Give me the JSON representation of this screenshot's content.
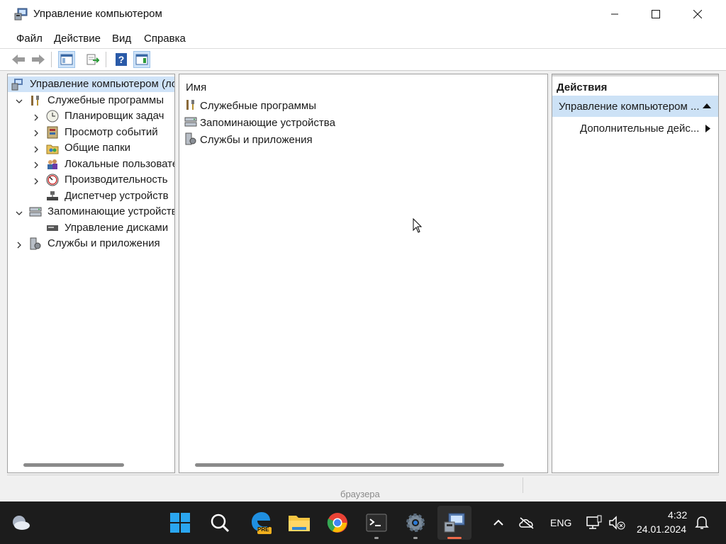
{
  "window": {
    "title": "Управление компьютером",
    "menu": [
      "Файл",
      "Действие",
      "Вид",
      "Справка"
    ]
  },
  "tree": {
    "root": "Управление компьютером (локальным)",
    "items": [
      {
        "label": "Служебные программы",
        "icon": "tools-icon"
      },
      {
        "label": "Планировщик задач",
        "icon": "clock-icon"
      },
      {
        "label": "Просмотр событий",
        "icon": "event-viewer-icon"
      },
      {
        "label": "Общие папки",
        "icon": "shared-folder-icon"
      },
      {
        "label": "Локальные пользователи и группы",
        "icon": "users-icon"
      },
      {
        "label": "Производительность",
        "icon": "performance-icon"
      },
      {
        "label": "Диспетчер устройств",
        "icon": "device-manager-icon"
      },
      {
        "label": "Запоминающие устройства",
        "icon": "storage-icon"
      },
      {
        "label": "Управление дисками",
        "icon": "disk-icon"
      },
      {
        "label": "Службы и приложения",
        "icon": "services-icon"
      }
    ]
  },
  "list": {
    "header": "Имя",
    "items": [
      "Служебные программы",
      "Запоминающие устройства",
      "Службы и приложения"
    ]
  },
  "actions": {
    "header": "Действия",
    "section": "Управление компьютером ...",
    "more": "Дополнительные дейс..."
  },
  "taskbar": {
    "bleed_text": "браузера",
    "lang": "ENG",
    "time": "4:32",
    "date": "24.01.2024",
    "pinned": [
      "start-icon",
      "search-icon",
      "edge-pre-icon",
      "file-explorer-icon",
      "chrome-icon",
      "terminal-icon",
      "settings-icon",
      "computer-management-icon"
    ],
    "pre_badge": "PRE"
  },
  "colors": {
    "accent_selection": "#cfe3f8",
    "section_highlight": "#cde2f6",
    "taskbar": "#1c1c1c"
  }
}
